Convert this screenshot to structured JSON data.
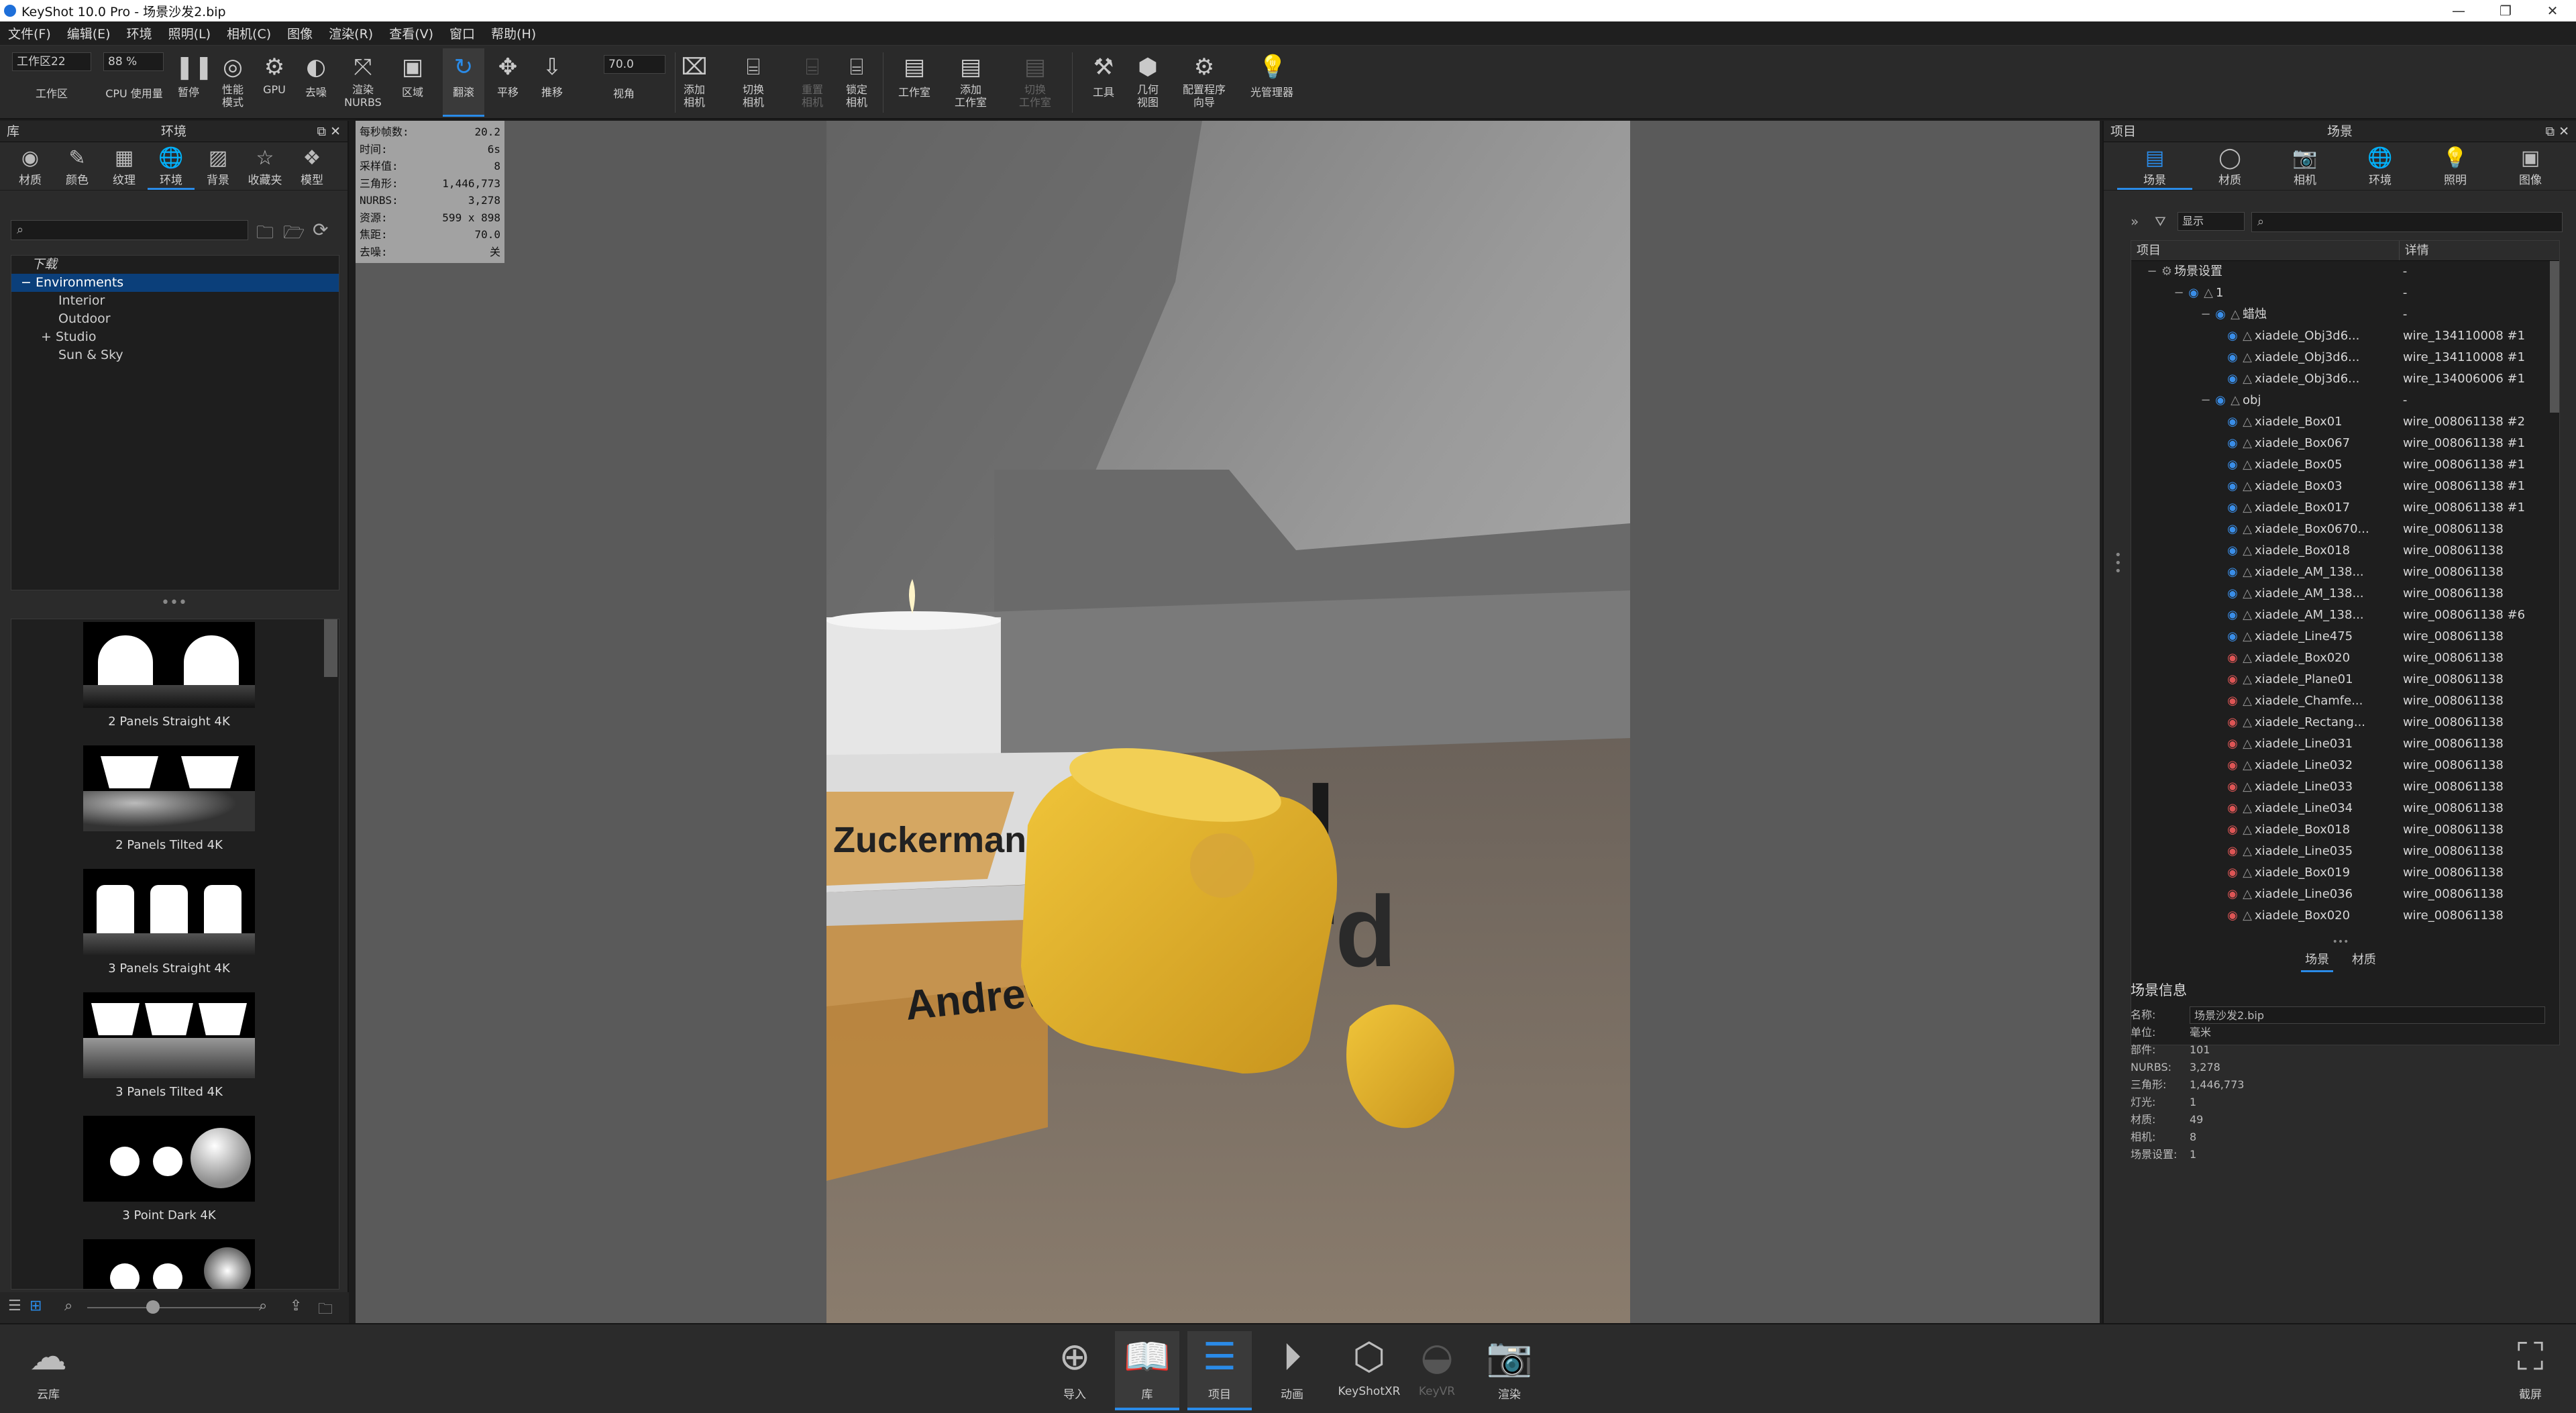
{
  "window": {
    "title": "KeyShot 10.0 Pro  - 场景沙发2.bip",
    "min": "—",
    "max": "❐",
    "close": "✕"
  },
  "menu": [
    "文件(F)",
    "编辑(E)",
    "环境",
    "照明(L)",
    "相机(C)",
    "图像",
    "渲染(R)",
    "查看(V)",
    "窗口",
    "帮助(H)"
  ],
  "toolbar": {
    "workspace_value": "工作区22",
    "workspace_label": "工作区",
    "cpu_value": "88 %",
    "cpu_label": "CPU 使用量",
    "fov_value": "70.0",
    "fov_label": "视角",
    "buttons": [
      {
        "label": "暂停",
        "icon": "pause-icon"
      },
      {
        "label": "性能\n模式",
        "icon": "performance-icon"
      },
      {
        "label": "GPU",
        "icon": "gpu-icon"
      },
      {
        "label": "去噪",
        "icon": "denoise-icon"
      },
      {
        "label": "渲染\nNURBS",
        "icon": "nurbs-icon"
      },
      {
        "label": "区域",
        "icon": "region-icon"
      },
      {
        "label": "翻滚",
        "icon": "tumble-icon"
      },
      {
        "label": "平移",
        "icon": "pan-icon"
      },
      {
        "label": "推移",
        "icon": "dolly-icon"
      },
      {
        "label": "添加\n相机",
        "icon": "add-camera-icon"
      },
      {
        "label": "切换\n相机",
        "icon": "switch-camera-icon"
      },
      {
        "label": "重置\n相机",
        "icon": "reset-camera-icon"
      },
      {
        "label": "锁定\n相机",
        "icon": "lock-camera-icon"
      },
      {
        "label": "工作室",
        "icon": "studio-icon"
      },
      {
        "label": "添加\n工作室",
        "icon": "add-studio-icon"
      },
      {
        "label": "切换\n工作室",
        "icon": "switch-studio-icon"
      },
      {
        "label": "工具",
        "icon": "tools-icon"
      },
      {
        "label": "几何\n视图",
        "icon": "geometry-view-icon"
      },
      {
        "label": "配置程序\n向导",
        "icon": "configurator-icon"
      },
      {
        "label": "光管理器",
        "icon": "light-manager-icon"
      }
    ]
  },
  "library": {
    "header_left": "库",
    "header_center": "环境",
    "tabs": [
      "材质",
      "颜色",
      "纹理",
      "环境",
      "背景",
      "收藏夹",
      "模型"
    ],
    "tree": [
      {
        "label": "下载"
      },
      {
        "label": "Environments"
      },
      {
        "label": "Interior"
      },
      {
        "label": "Outdoor"
      },
      {
        "label": "Studio"
      },
      {
        "label": "Sun & Sky"
      }
    ],
    "thumbnails": [
      "2 Panels Straight 4K",
      "2 Panels Tilted 4K",
      "3 Panels Straight 4K",
      "3 Panels Tilted 4K",
      "3 Point Dark 4K"
    ]
  },
  "hud": {
    "rows": [
      {
        "k": "每秒帧数:",
        "v": "20.2"
      },
      {
        "k": "时间:",
        "v": "6s"
      },
      {
        "k": "采样值:",
        "v": "8"
      },
      {
        "k": "三角形:",
        "v": "1,446,773"
      },
      {
        "k": "NURBS:",
        "v": "3,278"
      },
      {
        "k": "资源:",
        "v": "599 x 898"
      },
      {
        "k": "焦距:",
        "v": "70.0"
      },
      {
        "k": "去噪:",
        "v": "关"
      }
    ]
  },
  "render_text": {
    "book1": "Zuckerman",
    "book1_big": "Bird",
    "book2": "Andrew",
    "book2_big": "rd"
  },
  "scene": {
    "header_left": "项目",
    "header_center": "场景",
    "tabs": [
      "场景",
      "材质",
      "相机",
      "环境",
      "照明",
      "图像"
    ],
    "display_btn": "显示",
    "col_item": "项目",
    "col_detail": "详情",
    "rows": [
      {
        "name": "场景设置",
        "detail": "-",
        "indent": 0,
        "eye": ""
      },
      {
        "name": "1",
        "detail": "-",
        "indent": 1,
        "eye": "blue"
      },
      {
        "name": "蜡烛",
        "detail": "-",
        "indent": 2,
        "eye": "blue"
      },
      {
        "name": "xiadele_Obj3d6...",
        "detail": "wire_134110008 #1",
        "indent": 3,
        "eye": "blue"
      },
      {
        "name": "xiadele_Obj3d6...",
        "detail": "wire_134110008 #1",
        "indent": 3,
        "eye": "blue"
      },
      {
        "name": "xiadele_Obj3d6...",
        "detail": "wire_134006006 #1",
        "indent": 3,
        "eye": "blue"
      },
      {
        "name": "obj",
        "detail": "-",
        "indent": 2,
        "eye": "blue"
      },
      {
        "name": "xiadele_Box01",
        "detail": "wire_008061138 #2",
        "indent": 3,
        "eye": "blue"
      },
      {
        "name": "xiadele_Box067",
        "detail": "wire_008061138 #1",
        "indent": 3,
        "eye": "blue"
      },
      {
        "name": "xiadele_Box05",
        "detail": "wire_008061138 #1",
        "indent": 3,
        "eye": "blue"
      },
      {
        "name": "xiadele_Box03",
        "detail": "wire_008061138 #1",
        "indent": 3,
        "eye": "blue"
      },
      {
        "name": "xiadele_Box017",
        "detail": "wire_008061138 #1",
        "indent": 3,
        "eye": "blue"
      },
      {
        "name": "xiadele_Box0670...",
        "detail": "wire_008061138",
        "indent": 3,
        "eye": "blue"
      },
      {
        "name": "xiadele_Box018",
        "detail": "wire_008061138",
        "indent": 3,
        "eye": "blue"
      },
      {
        "name": "xiadele_AM_138...",
        "detail": "wire_008061138",
        "indent": 3,
        "eye": "blue"
      },
      {
        "name": "xiadele_AM_138...",
        "detail": "wire_008061138",
        "indent": 3,
        "eye": "blue"
      },
      {
        "name": "xiadele_AM_138...",
        "detail": "wire_008061138 #6",
        "indent": 3,
        "eye": "blue"
      },
      {
        "name": "xiadele_Line475",
        "detail": "wire_008061138",
        "indent": 3,
        "eye": "blue"
      },
      {
        "name": "xiadele_Box020",
        "detail": "wire_008061138",
        "indent": 3,
        "eye": "red"
      },
      {
        "name": "xiadele_Plane01",
        "detail": "wire_008061138",
        "indent": 3,
        "eye": "red"
      },
      {
        "name": "xiadele_Chamfe...",
        "detail": "wire_008061138",
        "indent": 3,
        "eye": "red"
      },
      {
        "name": "xiadele_Rectang...",
        "detail": "wire_008061138",
        "indent": 3,
        "eye": "red"
      },
      {
        "name": "xiadele_Line031",
        "detail": "wire_008061138",
        "indent": 3,
        "eye": "red"
      },
      {
        "name": "xiadele_Line032",
        "detail": "wire_008061138",
        "indent": 3,
        "eye": "red"
      },
      {
        "name": "xiadele_Line033",
        "detail": "wire_008061138",
        "indent": 3,
        "eye": "red"
      },
      {
        "name": "xiadele_Line034",
        "detail": "wire_008061138",
        "indent": 3,
        "eye": "red"
      },
      {
        "name": "xiadele_Box018",
        "detail": "wire_008061138",
        "indent": 3,
        "eye": "red"
      },
      {
        "name": "xiadele_Line035",
        "detail": "wire_008061138",
        "indent": 3,
        "eye": "red"
      },
      {
        "name": "xiadele_Box019",
        "detail": "wire_008061138",
        "indent": 3,
        "eye": "red"
      },
      {
        "name": "xiadele_Line036",
        "detail": "wire_008061138",
        "indent": 3,
        "eye": "red"
      },
      {
        "name": "xiadele_Box020",
        "detail": "wire_008061138",
        "indent": 3,
        "eye": "red"
      }
    ],
    "subtab_scene": "场景",
    "subtab_material": "材质",
    "info_title": "场景信息",
    "info": [
      {
        "k": "名称:",
        "v": "场景沙发2.bip"
      },
      {
        "k": "单位:",
        "v": "毫米"
      },
      {
        "k": "部件:",
        "v": "101"
      },
      {
        "k": "NURBS:",
        "v": "3,278"
      },
      {
        "k": "三角形:",
        "v": "1,446,773"
      },
      {
        "k": "灯光:",
        "v": "1"
      },
      {
        "k": "材质:",
        "v": "49"
      },
      {
        "k": "相机:",
        "v": "8"
      },
      {
        "k": "场景设置:",
        "v": "1"
      }
    ]
  },
  "bottom": {
    "cloud": "云库",
    "buttons": [
      {
        "label": "导入"
      },
      {
        "label": "库"
      },
      {
        "label": "项目"
      },
      {
        "label": "动画"
      },
      {
        "label": "KeyShotXR"
      },
      {
        "label": "KeyVR"
      },
      {
        "label": "渲染"
      }
    ],
    "screenshot": "截屏"
  },
  "colors": {
    "accent": "#2a8be8",
    "selection": "#0b3f7a",
    "product": "#e8b830"
  }
}
